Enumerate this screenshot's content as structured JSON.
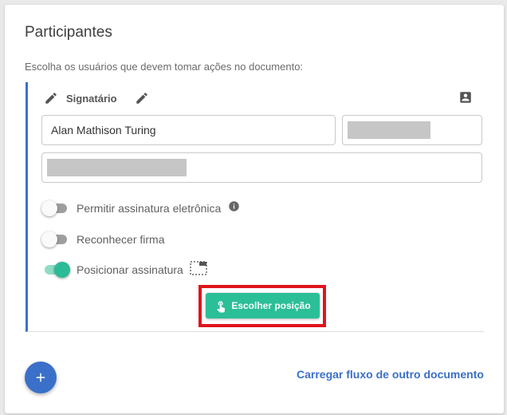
{
  "card": {
    "title": "Participantes",
    "subtitle": "Escolha os usuários que devem tomar ações no documento:"
  },
  "participant": {
    "role": {
      "label": "Signatário",
      "icon": "pen-icon",
      "edit_icon": "pencil-icon",
      "contact_icon": "contact-card-icon"
    },
    "fields": {
      "name": {
        "value": "Alan Mathison Turing"
      },
      "email": {
        "value": ""
      },
      "cpf": {
        "value": ""
      }
    },
    "options": [
      {
        "label": "Permitir assinatura eletrônica",
        "enabled": false,
        "icon": "info-icon"
      },
      {
        "label": "Reconhecer firma",
        "enabled": false
      },
      {
        "label": "Posicionar assinatura",
        "enabled": true,
        "icon": "signature-position-icon"
      }
    ],
    "choose_position_button": {
      "label": "Escolher posição",
      "icon": "touch-icon"
    }
  },
  "footer": {
    "add_icon": "plus-icon",
    "load_flow_link": "Carregar fluxo de outro documento"
  },
  "colors": {
    "accent": "#3a70c9",
    "success": "#2bbf98",
    "highlight": "#e0141c"
  }
}
